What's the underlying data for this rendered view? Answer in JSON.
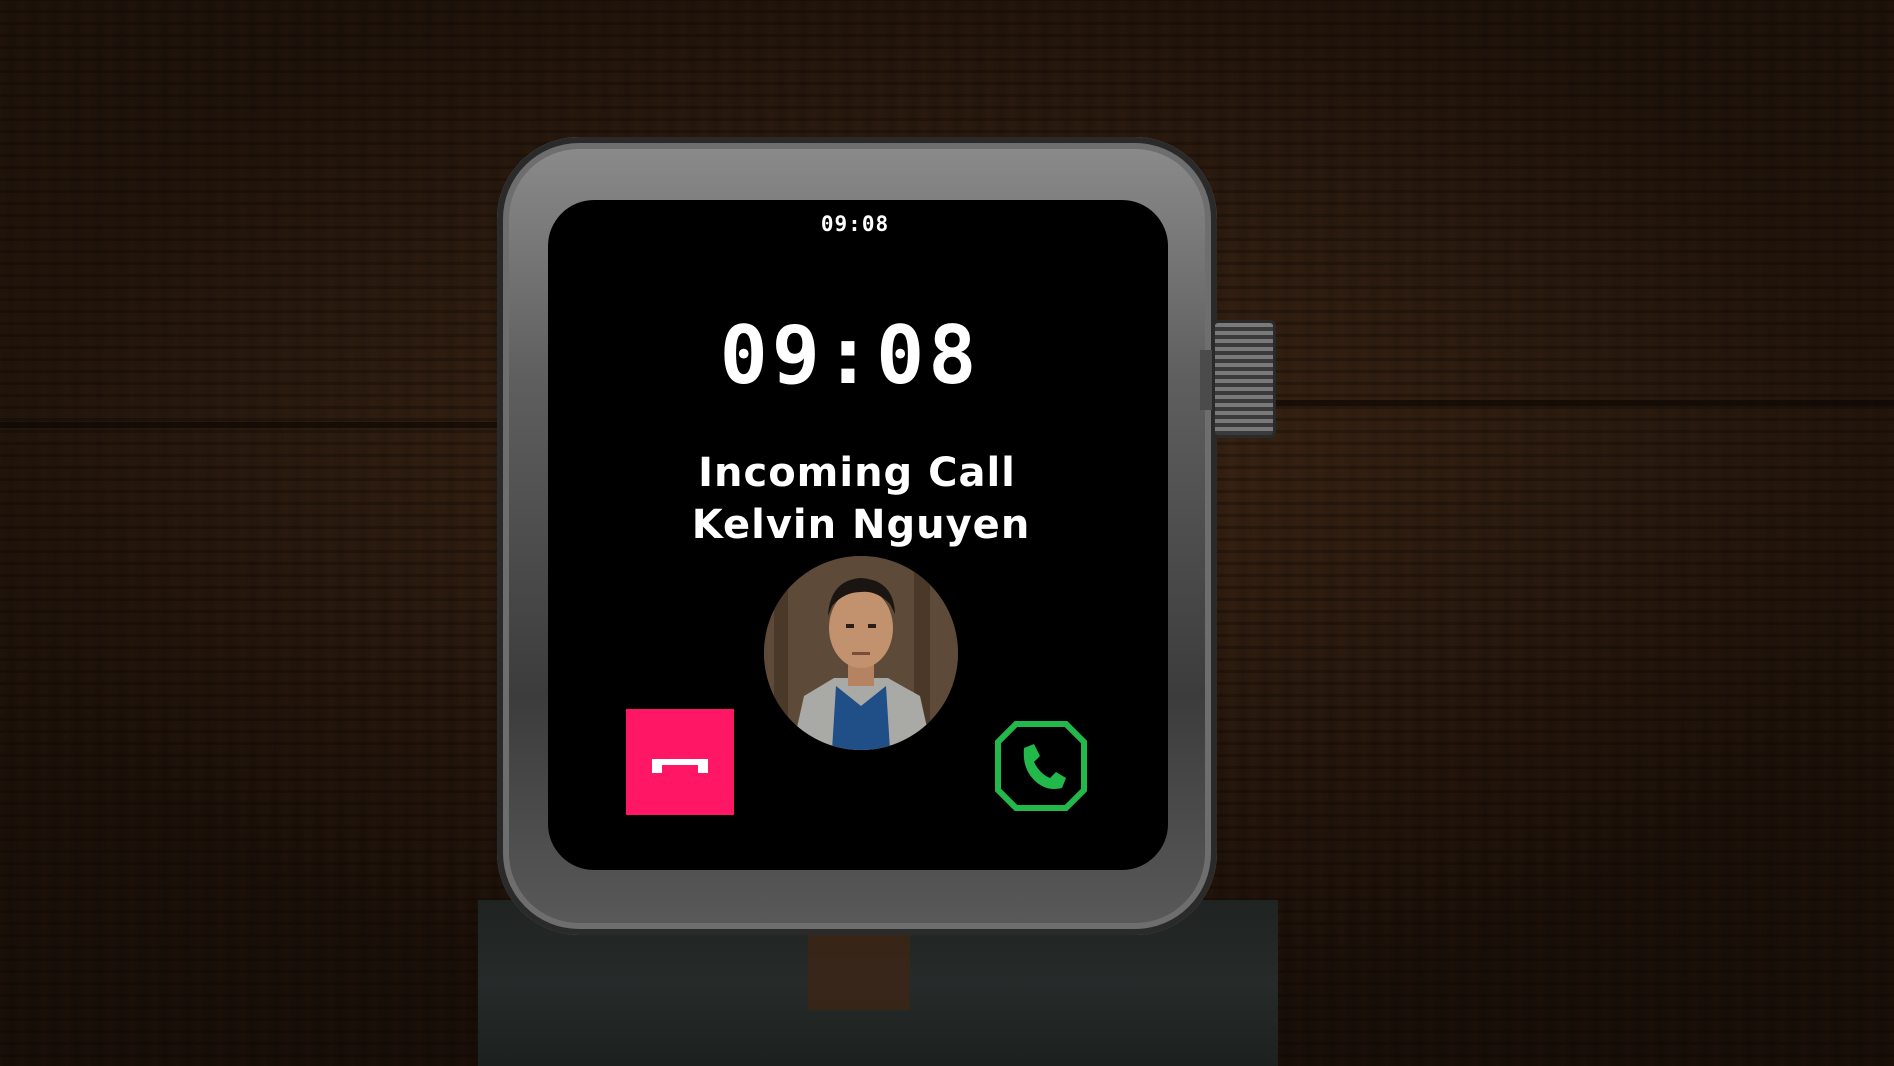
{
  "watch": {
    "status_time": "09:08",
    "clock_time": "09:08",
    "call_label": "Incoming Call",
    "caller_name": "Kelvin Nguyen"
  },
  "buttons": {
    "decline_icon": "hang-up-icon",
    "accept_icon": "phone-icon"
  },
  "colors": {
    "decline": "#ff1766",
    "accept": "#22b84a",
    "screen": "#000000",
    "text": "#ffffff"
  }
}
